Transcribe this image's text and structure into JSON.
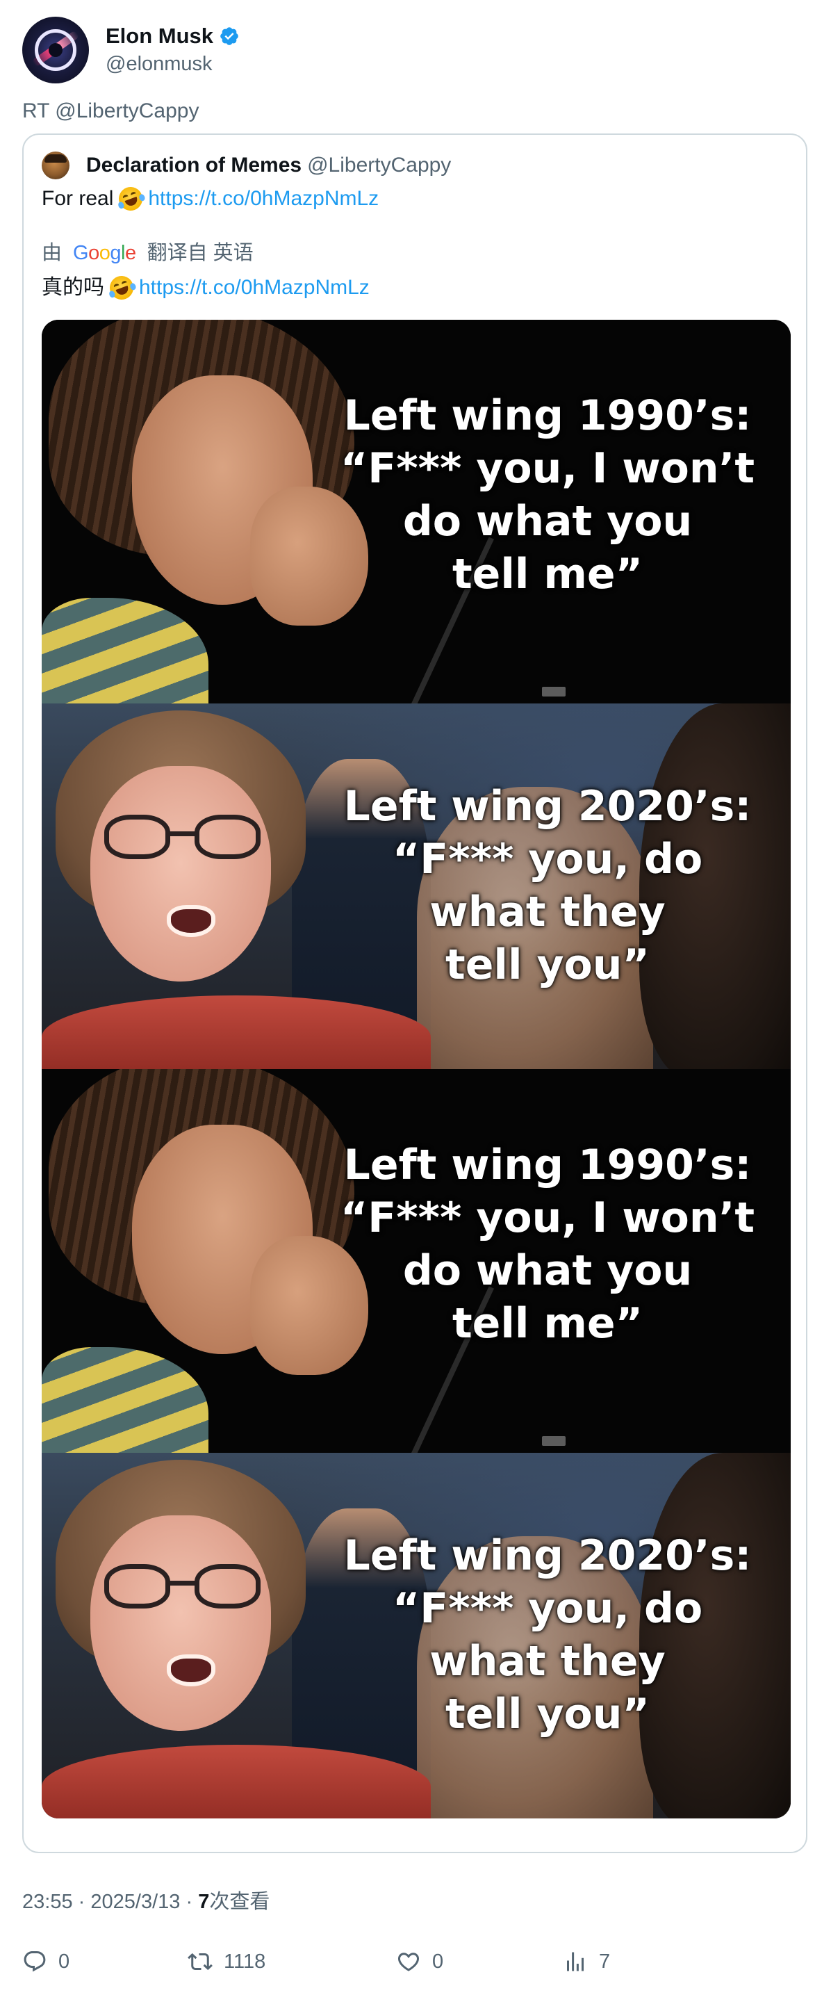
{
  "author": {
    "display_name": "Elon Musk",
    "handle": "@elonmusk",
    "verified": true
  },
  "retweet_label": "RT @LibertyCappy",
  "quoted": {
    "display_name": "Declaration of Memes",
    "handle": "@LibertyCappy",
    "text_before_emoji": "For real",
    "emoji": "rolling-on-floor-laughing",
    "link": "https://t.co/0hMazpNmLz",
    "translation": {
      "prefix": "由",
      "provider": "Google",
      "suffix": "翻译自 英语",
      "text_before_emoji": "真的吗",
      "link": "https://t.co/0hMazpNmLz"
    },
    "meme": {
      "captions": [
        "Left wing 1990’s:\n“F*** you, I won’t\ndo what you\ntell me”",
        "Left wing 2020’s:\n“F*** you, do\nwhat they\ntell you”",
        "Left wing 1990’s:\n“F*** you, I won’t\ndo what you\ntell me”",
        "Left wing 2020’s:\n“F*** you, do\nwhat they\ntell you”"
      ]
    }
  },
  "meta": {
    "time": "23:55",
    "separator": "·",
    "date": "2025/3/13",
    "views_count": "7",
    "views_label": "次查看"
  },
  "actions": {
    "replies": "0",
    "retweets": "1118",
    "likes": "0",
    "views": "7"
  },
  "colors": {
    "text_primary": "#0f1419",
    "text_secondary": "#536471",
    "link": "#1d9bf0",
    "border": "#cfd9de",
    "verified": "#1d9bf0"
  }
}
